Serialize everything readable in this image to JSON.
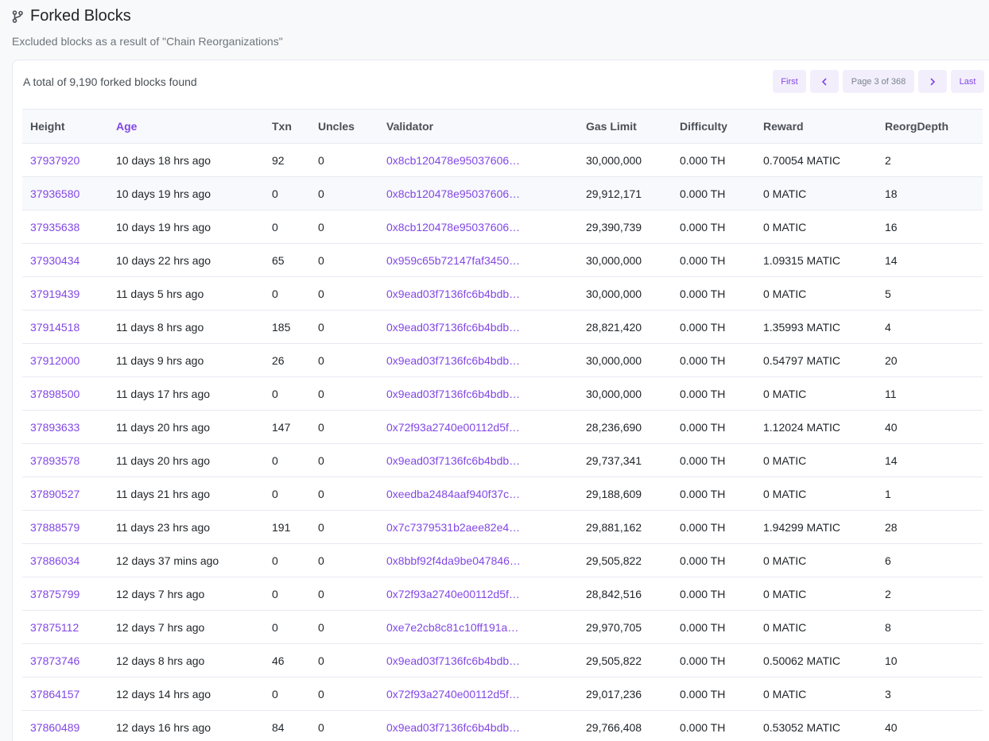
{
  "page": {
    "title": "Forked Blocks",
    "subtitle": "Excluded blocks as a result of \"Chain Reorganizations\"",
    "title_icon": "git-fork-icon"
  },
  "summary": {
    "total_text": "A total of 9,190 forked blocks found"
  },
  "pagination": {
    "first": "First",
    "prev_icon": "chevron-left-icon",
    "info": "Page 3 of 368",
    "next_icon": "chevron-right-icon",
    "last": "Last"
  },
  "colors": {
    "accent": "#8247e5",
    "muted": "#6c757d"
  },
  "table": {
    "headers": [
      "Height",
      "Age",
      "Txn",
      "Uncles",
      "Validator",
      "Gas Limit",
      "Difficulty",
      "Reward",
      "ReorgDepth"
    ],
    "rows": [
      [
        "37937920",
        "10 days 18 hrs ago",
        "92",
        "0",
        "0x8cb120478e95037606…",
        "30,000,000",
        "0.000 TH",
        "0.70054 MATIC",
        "2"
      ],
      [
        "37936580",
        "10 days 19 hrs ago",
        "0",
        "0",
        "0x8cb120478e95037606…",
        "29,912,171",
        "0.000 TH",
        "0 MATIC",
        "18"
      ],
      [
        "37935638",
        "10 days 19 hrs ago",
        "0",
        "0",
        "0x8cb120478e95037606…",
        "29,390,739",
        "0.000 TH",
        "0 MATIC",
        "16"
      ],
      [
        "37930434",
        "10 days 22 hrs ago",
        "65",
        "0",
        "0x959c65b72147faf3450…",
        "30,000,000",
        "0.000 TH",
        "1.09315 MATIC",
        "14"
      ],
      [
        "37919439",
        "11 days 5 hrs ago",
        "0",
        "0",
        "0x9ead03f7136fc6b4bdb…",
        "30,000,000",
        "0.000 TH",
        "0 MATIC",
        "5"
      ],
      [
        "37914518",
        "11 days 8 hrs ago",
        "185",
        "0",
        "0x9ead03f7136fc6b4bdb…",
        "28,821,420",
        "0.000 TH",
        "1.35993 MATIC",
        "4"
      ],
      [
        "37912000",
        "11 days 9 hrs ago",
        "26",
        "0",
        "0x9ead03f7136fc6b4bdb…",
        "30,000,000",
        "0.000 TH",
        "0.54797 MATIC",
        "20"
      ],
      [
        "37898500",
        "11 days 17 hrs ago",
        "0",
        "0",
        "0x9ead03f7136fc6b4bdb…",
        "30,000,000",
        "0.000 TH",
        "0 MATIC",
        "11"
      ],
      [
        "37893633",
        "11 days 20 hrs ago",
        "147",
        "0",
        "0x72f93a2740e00112d5f…",
        "28,236,690",
        "0.000 TH",
        "1.12024 MATIC",
        "40"
      ],
      [
        "37893578",
        "11 days 20 hrs ago",
        "0",
        "0",
        "0x9ead03f7136fc6b4bdb…",
        "29,737,341",
        "0.000 TH",
        "0 MATIC",
        "14"
      ],
      [
        "37890527",
        "11 days 21 hrs ago",
        "0",
        "0",
        "0xeedba2484aaf940f37c…",
        "29,188,609",
        "0.000 TH",
        "0 MATIC",
        "1"
      ],
      [
        "37888579",
        "11 days 23 hrs ago",
        "191",
        "0",
        "0x7c7379531b2aee82e4…",
        "29,881,162",
        "0.000 TH",
        "1.94299 MATIC",
        "28"
      ],
      [
        "37886034",
        "12 days 37 mins ago",
        "0",
        "0",
        "0x8bbf92f4da9be047846…",
        "29,505,822",
        "0.000 TH",
        "0 MATIC",
        "6"
      ],
      [
        "37875799",
        "12 days 7 hrs ago",
        "0",
        "0",
        "0x72f93a2740e00112d5f…",
        "28,842,516",
        "0.000 TH",
        "0 MATIC",
        "2"
      ],
      [
        "37875112",
        "12 days 7 hrs ago",
        "0",
        "0",
        "0xe7e2cb8c81c10ff191a…",
        "29,970,705",
        "0.000 TH",
        "0 MATIC",
        "8"
      ],
      [
        "37873746",
        "12 days 8 hrs ago",
        "46",
        "0",
        "0x9ead03f7136fc6b4bdb…",
        "29,505,822",
        "0.000 TH",
        "0.50062 MATIC",
        "10"
      ],
      [
        "37864157",
        "12 days 14 hrs ago",
        "0",
        "0",
        "0x72f93a2740e00112d5f…",
        "29,017,236",
        "0.000 TH",
        "0 MATIC",
        "3"
      ],
      [
        "37860489",
        "12 days 16 hrs ago",
        "84",
        "0",
        "0x9ead03f7136fc6b4bdb…",
        "29,766,408",
        "0.000 TH",
        "0.53052 MATIC",
        "40"
      ]
    ]
  }
}
